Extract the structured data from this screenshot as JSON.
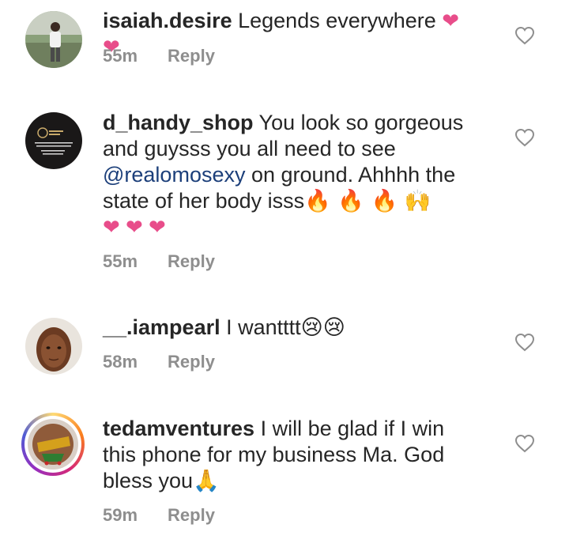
{
  "comments": [
    {
      "username": "isaiah.desire",
      "text": " Legends everywhere",
      "emojis": "❤ ❤",
      "time": "55m",
      "reply": "Reply"
    },
    {
      "username": "d_handy_shop",
      "text_1": " You look so gorgeous and guysss you all need to see ",
      "mention": "@realomosexy",
      "text_2": " on ground. Ahhhh the state of her body isss",
      "emojis_fire": "🔥 🔥 🔥 🙌",
      "emojis_hearts": "❤ ❤ ❤",
      "time": "55m",
      "reply": "Reply"
    },
    {
      "username": "__.iampearl",
      "text": " I wantttt",
      "emojis": "😢😢",
      "time": "58m",
      "reply": "Reply"
    },
    {
      "username": "tedamventures",
      "text": " I will be glad if I win this  phone for my business Ma. God bless you",
      "emojis": "🙏",
      "time": "59m",
      "reply": "Reply"
    }
  ],
  "colors": {
    "text": "#262626",
    "muted": "#8e8e8e",
    "mention": "#1c3f7a",
    "heart": "#e84d8a"
  },
  "icons": {
    "like": "heart-outline-icon"
  }
}
